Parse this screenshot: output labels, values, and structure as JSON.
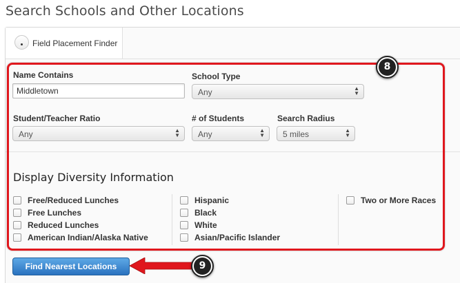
{
  "page": {
    "title": "Search Schools and Other Locations"
  },
  "tabs": [
    {
      "label": "Field Placement Finder",
      "selected": true
    }
  ],
  "form": {
    "name_contains": {
      "label": "Name Contains",
      "value": "Middletown"
    },
    "school_type": {
      "label": "School Type",
      "value": "Any"
    },
    "student_teacher_ratio": {
      "label": "Student/Teacher Ratio",
      "value": "Any"
    },
    "num_students": {
      "label": "# of Students",
      "value": "Any"
    },
    "search_radius": {
      "label": "Search Radius",
      "value": "5 miles"
    }
  },
  "diversity": {
    "title": "Display Diversity Information",
    "columns": [
      [
        "Free/Reduced Lunches",
        "Free Lunches",
        "Reduced Lunches",
        "American Indian/Alaska Native"
      ],
      [
        "Hispanic",
        "Black",
        "White",
        "Asian/Pacific Islander"
      ],
      [
        "Two or More Races"
      ]
    ]
  },
  "actions": {
    "find_label": "Find Nearest Locations"
  },
  "annotations": {
    "badge_8": "8",
    "badge_9": "9",
    "highlight_color": "#e0171d"
  }
}
